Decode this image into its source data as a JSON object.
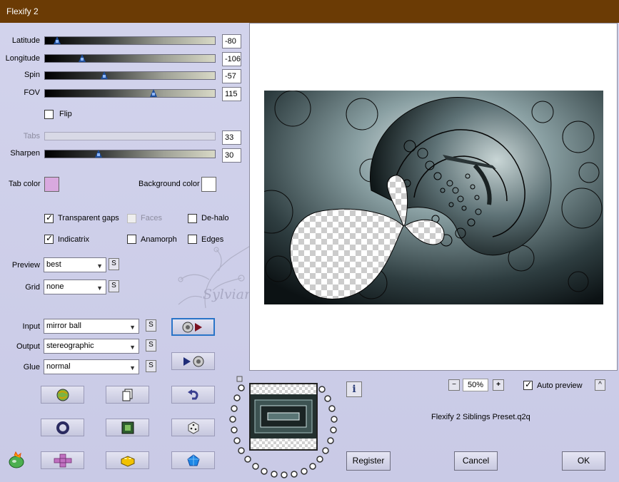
{
  "window": {
    "title": "Flexify 2"
  },
  "params": {
    "latitude": {
      "label": "Latitude",
      "value": "-80",
      "fraction": 0.07
    },
    "longitude": {
      "label": "Longitude",
      "value": "-106",
      "fraction": 0.22
    },
    "spin": {
      "label": "Spin",
      "value": "-57",
      "fraction": 0.34
    },
    "fov": {
      "label": "FOV",
      "value": "115",
      "fraction": 0.64
    },
    "flip": {
      "label": "Flip",
      "checked": false
    },
    "tabs": {
      "label": "Tabs",
      "value": "33"
    },
    "sharpen": {
      "label": "Sharpen",
      "value": "30",
      "fraction": 0.31
    }
  },
  "colors": {
    "tab_color_label": "Tab color",
    "tab_color": "#d9a9df",
    "background_color_label": "Background color",
    "background_color": "#ffffff",
    "accent": "#1f4e9a",
    "titlebar": "#6b3b05"
  },
  "options": {
    "transparent_gaps": {
      "label": "Transparent gaps",
      "checked": true
    },
    "faces": {
      "label": "Faces",
      "checked": false
    },
    "dehalo": {
      "label": "De-halo",
      "checked": false
    },
    "indicatrix": {
      "label": "Indicatrix",
      "checked": true
    },
    "anamorph": {
      "label": "Anamorph",
      "checked": false
    },
    "edges": {
      "label": "Edges",
      "checked": false
    }
  },
  "preview_select": {
    "label": "Preview",
    "value": "best",
    "s": "S"
  },
  "grid_select": {
    "label": "Grid",
    "value": "none",
    "s": "S"
  },
  "input_select": {
    "label": "Input",
    "value": "mirror ball",
    "s": "S"
  },
  "output_select": {
    "label": "Output",
    "value": "stereographic",
    "s": "S"
  },
  "glue_select": {
    "label": "Glue",
    "value": "normal",
    "s": "S"
  },
  "watermark": "Sylviane",
  "zoom": {
    "value": "50%",
    "minus": "−",
    "plus": "+"
  },
  "auto_preview": {
    "label": "Auto preview",
    "checked": true,
    "up": "^"
  },
  "preset_name": "Flexify 2 Siblings Preset.q2q",
  "info": "i",
  "buttons": {
    "register": "Register",
    "cancel": "Cancel",
    "ok": "OK"
  },
  "icons": {
    "toolbar": [
      "globe-icon",
      "copy-icon",
      "undo-icon",
      "ring-icon",
      "square-icon",
      "dice-icon",
      "puzzle-plus-icon",
      "brick-icon",
      "gem-icon"
    ],
    "io": [
      "sphere-play-icon",
      "play-sphere-icon"
    ],
    "app": "app-logo-icon"
  }
}
